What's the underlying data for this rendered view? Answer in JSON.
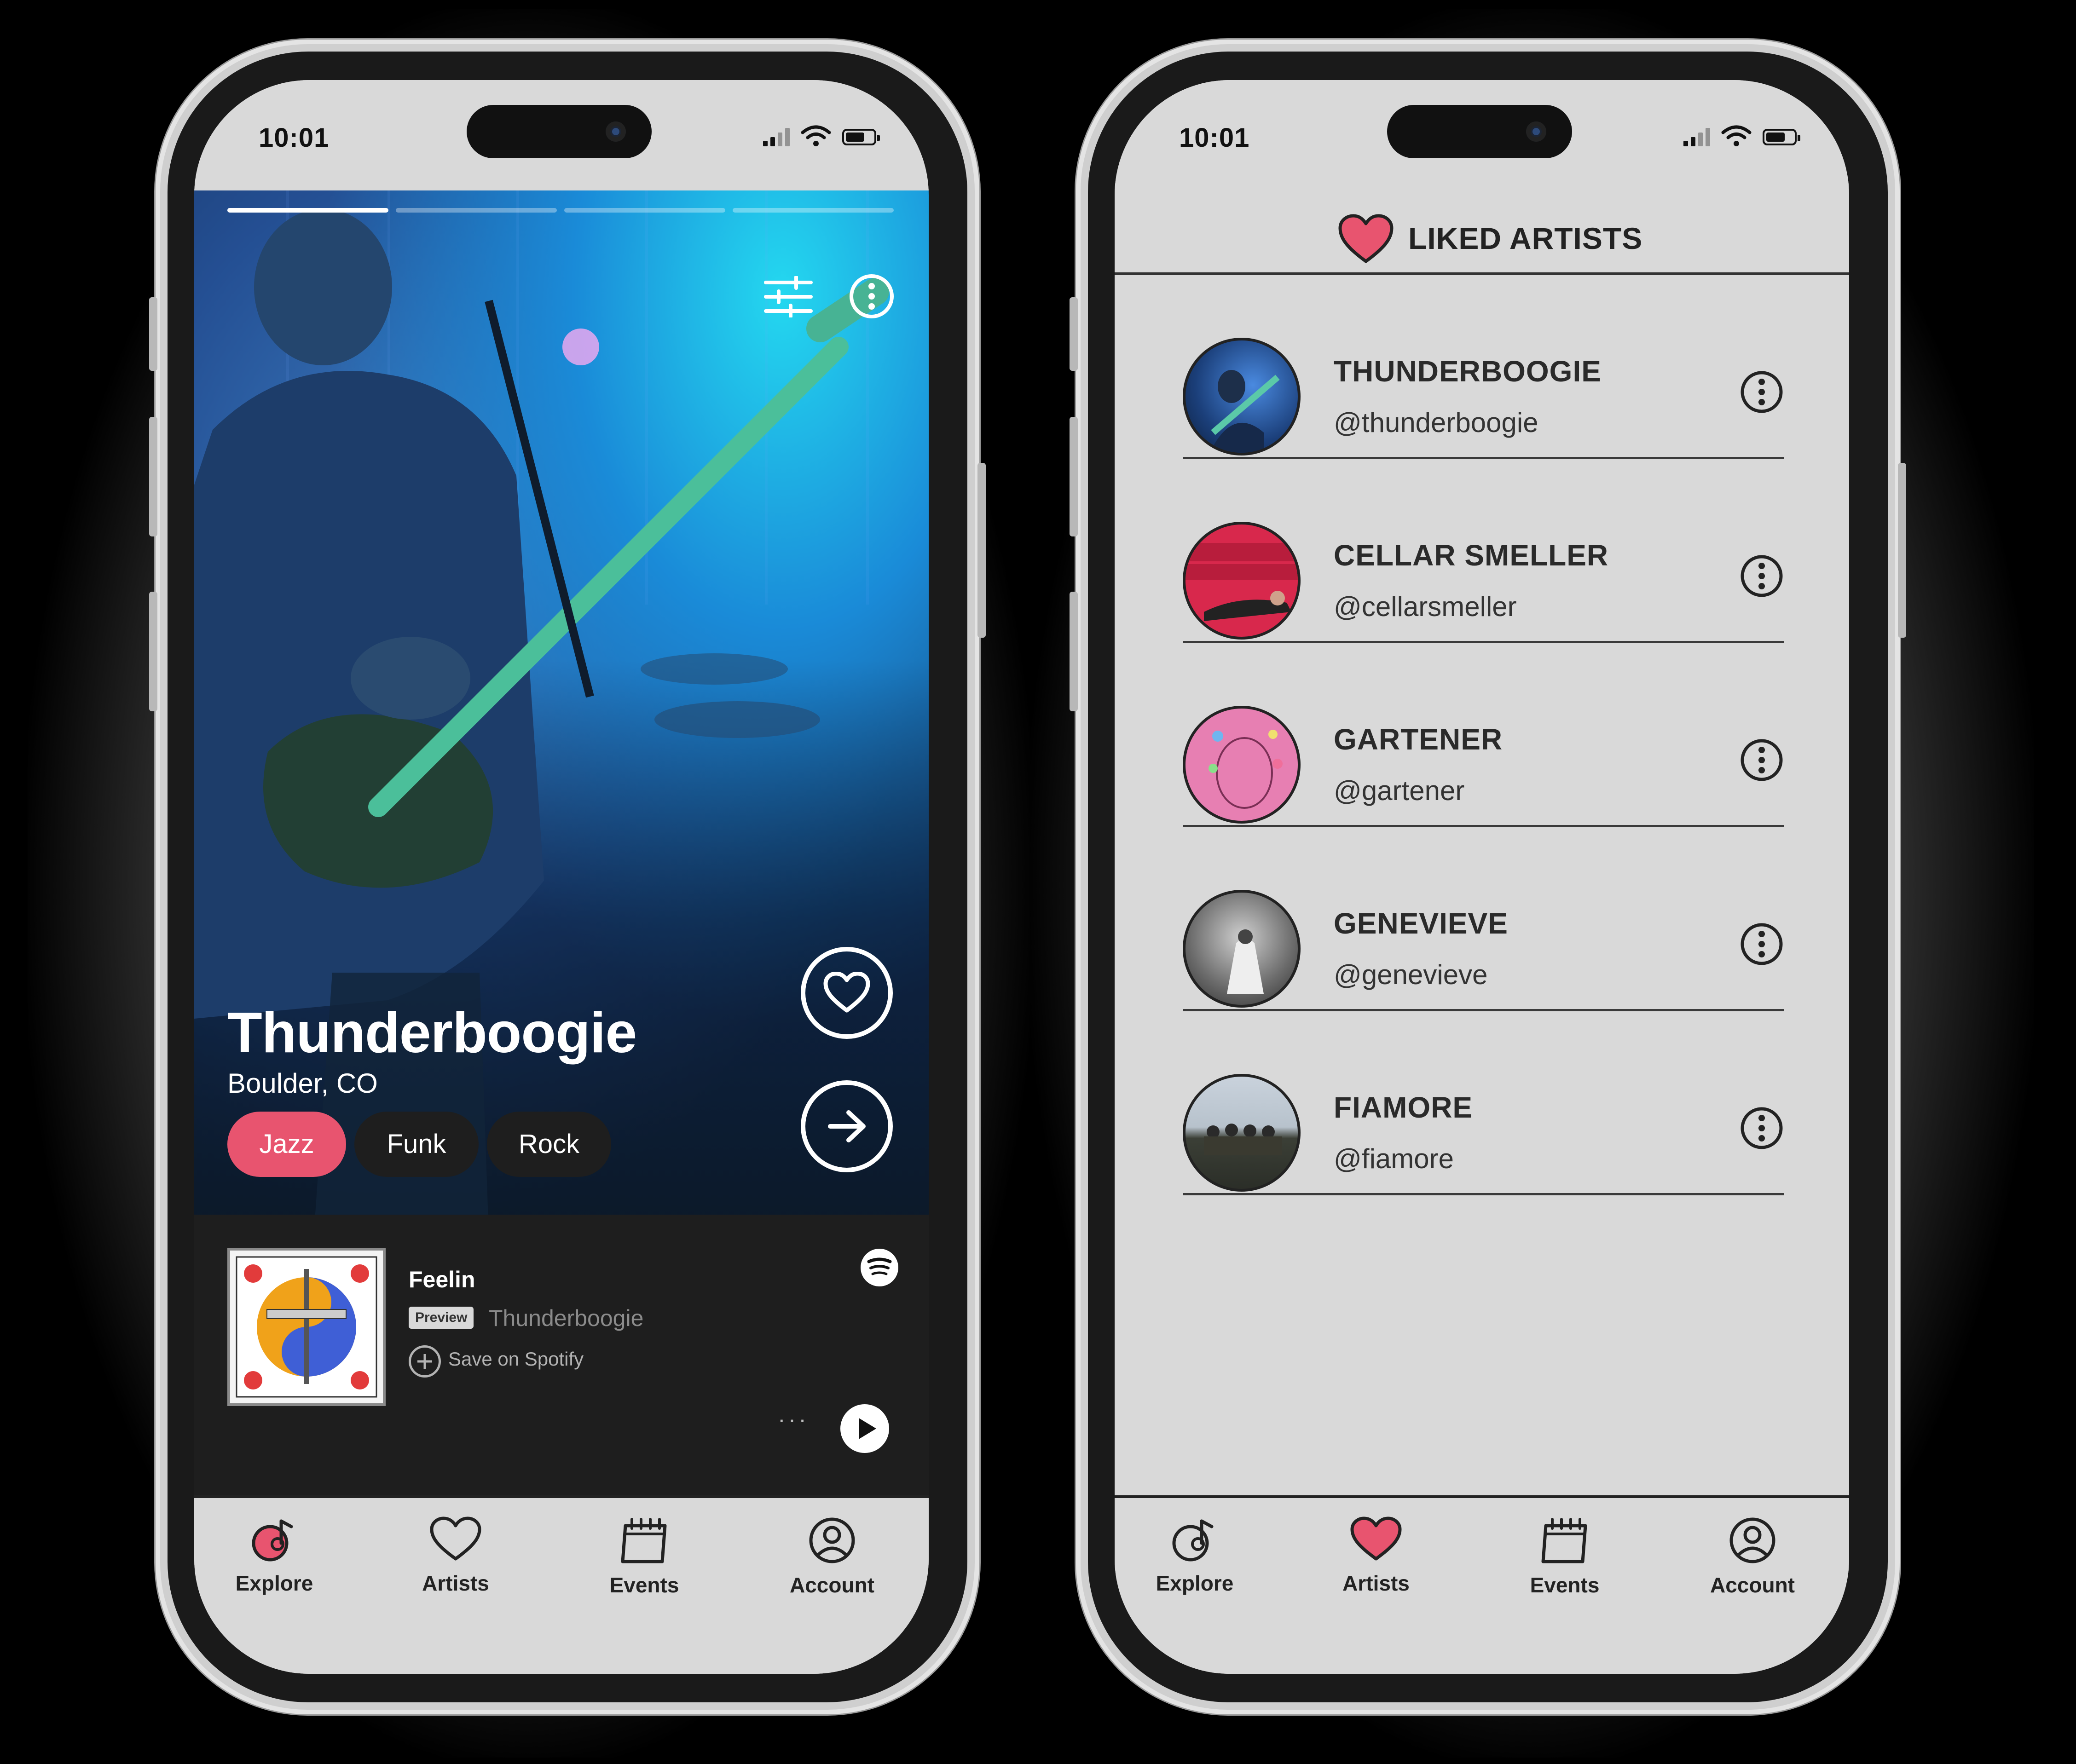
{
  "left_phone": {
    "status": {
      "time": "10:01"
    },
    "hero": {
      "artist_name": "Thunderboogie",
      "location": "Boulder, CO",
      "genres": [
        {
          "label": "Jazz",
          "active": true
        },
        {
          "label": "Funk",
          "active": false
        },
        {
          "label": "Rock",
          "active": false
        }
      ],
      "story_segments": 4,
      "active_segment": 1
    },
    "player": {
      "track_title": "Feelin",
      "preview_badge": "Preview",
      "track_artist": "Thunderboogie",
      "save_label": "Save on Spotify",
      "more_label": "···"
    },
    "nav": {
      "items": [
        {
          "label": "Explore",
          "icon": "explore-icon",
          "active": true
        },
        {
          "label": "Artists",
          "icon": "heart-icon",
          "active": false
        },
        {
          "label": "Events",
          "icon": "calendar-icon",
          "active": false
        },
        {
          "label": "Account",
          "icon": "account-icon",
          "active": false
        }
      ]
    }
  },
  "right_phone": {
    "status": {
      "time": "10:01"
    },
    "header": {
      "title": "LIKED ARTISTS"
    },
    "artists": [
      {
        "name": "THUNDERBOOGIE",
        "handle": "@thunderboogie"
      },
      {
        "name": "CELLAR SMELLER",
        "handle": "@cellarsmeller"
      },
      {
        "name": "GARTENER",
        "handle": "@gartener"
      },
      {
        "name": "GENEVIEVE",
        "handle": "@genevieve"
      },
      {
        "name": "FIAMORE",
        "handle": "@fiamore"
      }
    ],
    "nav": {
      "items": [
        {
          "label": "Explore",
          "icon": "explore-icon",
          "active": false
        },
        {
          "label": "Artists",
          "icon": "heart-icon",
          "active": true
        },
        {
          "label": "Events",
          "icon": "calendar-icon",
          "active": false
        },
        {
          "label": "Account",
          "icon": "account-icon",
          "active": false
        }
      ]
    }
  },
  "colors": {
    "accent_pink": "#e8546f",
    "chip_dark": "#1e1e1e",
    "screen_bg": "#d9d9d9"
  }
}
